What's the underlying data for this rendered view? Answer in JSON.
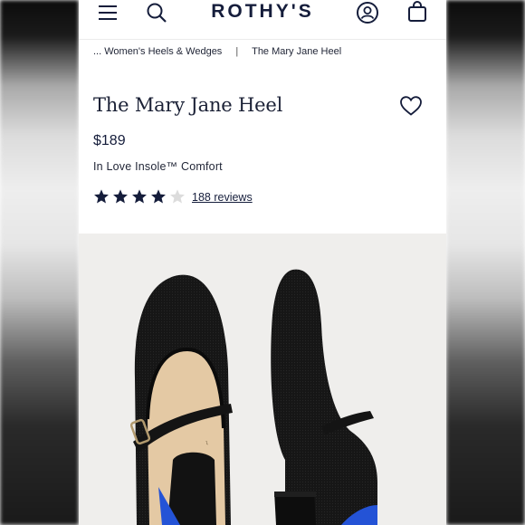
{
  "header": {
    "logo": "ROTHY'S",
    "icons": [
      "menu-icon",
      "search-icon",
      "account-icon",
      "bag-icon"
    ]
  },
  "breadcrumb": {
    "items": [
      "... Women's Heels & Wedges",
      "The Mary Jane Heel"
    ],
    "separator": "|"
  },
  "product": {
    "name": "The Mary Jane Heel",
    "price": "$189",
    "feature": "In Love Insole™ Comfort",
    "rating": {
      "value": 4,
      "max": 5,
      "reviews_label": "188 reviews"
    }
  },
  "colors": {
    "brand_navy": "#151d3b",
    "star_filled": "#151d3b",
    "star_empty": "#d7d7d7",
    "photo_bg": "#efeeec",
    "shoe": "#151515",
    "accent_blue": "#2453d6",
    "insole": "#e3c9a6"
  }
}
